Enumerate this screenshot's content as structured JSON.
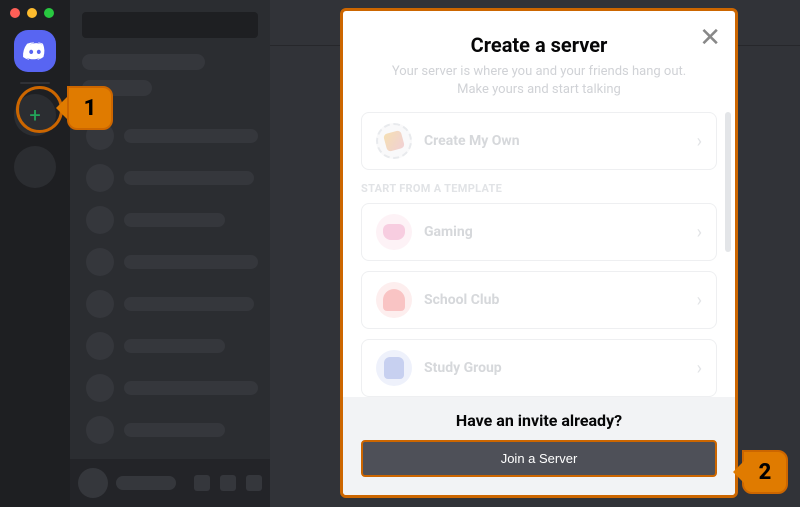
{
  "callouts": {
    "one": "1",
    "two": "2"
  },
  "modal": {
    "title": "Create a server",
    "subtitle": "Your server is where you and your friends hang out. Make yours and start talking",
    "close_label": "✕",
    "create_my_own": "Create My Own",
    "template_header": "START FROM A TEMPLATE",
    "templates": [
      {
        "label": "Gaming",
        "icon": "gaming"
      },
      {
        "label": "School Club",
        "icon": "school"
      },
      {
        "label": "Study Group",
        "icon": "study"
      }
    ],
    "invite_prompt": "Have an invite already?",
    "join_button": "Join a Server",
    "chevron": "›"
  }
}
